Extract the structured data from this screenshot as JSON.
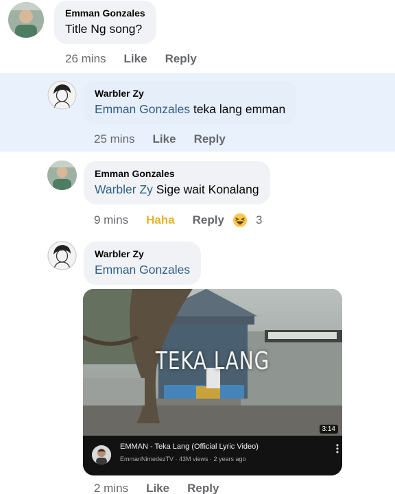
{
  "comments": [
    {
      "author": "Emman Gonzales",
      "mention": "",
      "text": "Title Ng song?",
      "time": "26 mins",
      "like": "Like",
      "reply": "Reply"
    },
    {
      "author": "Warbler Zy",
      "mention": "Emman Gonzales",
      "text": " teka lang emman",
      "time": "25 mins",
      "like": "Like",
      "reply": "Reply"
    },
    {
      "author": "Emman Gonzales",
      "mention": "Warbler Zy",
      "text": " Sige wait Konalang",
      "time": "9 mins",
      "reaction": "Haha",
      "reply": "Reply",
      "reaction_icon": "haha-emoji-icon",
      "reaction_count": "3"
    },
    {
      "author": "Warbler Zy",
      "mention": "Emman Gonzales",
      "text": "",
      "time": "2 mins",
      "like": "Like",
      "reply": "Reply"
    }
  ],
  "video": {
    "overlay_title": "TEKA LANG",
    "duration": "3:14",
    "title": "EMMAN - Teka Lang (Official Lyric Video)",
    "subtitle": "EmmanNimedezTV · 43M views · 2 years ago"
  },
  "colors": {
    "highlight": "#e8f1fc",
    "mention": "#2f5f86",
    "haha": "#e7b22e",
    "meta": "#65676b",
    "bubble": "#f0f2f5"
  }
}
